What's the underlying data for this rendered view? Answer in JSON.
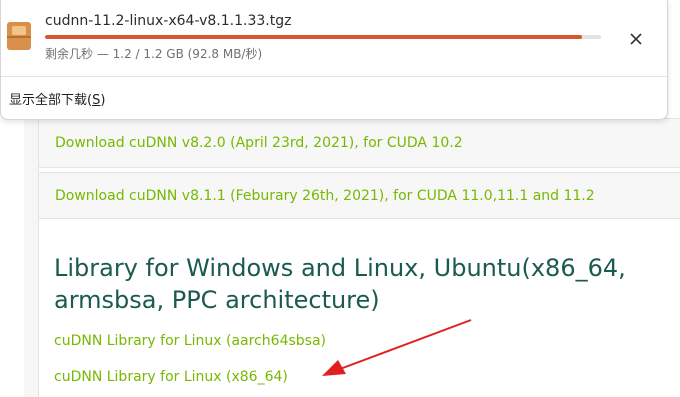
{
  "downloads_panel": {
    "file_name": "cudnn-11.2-linux-x64-v8.1.1.33.tgz",
    "progress_fraction": 0.965,
    "status_text": "剩余几秒 — 1.2 / 1.2 GB (92.8 MB/秒)",
    "show_all_label": "显示全部下载(",
    "show_all_key": "S",
    "show_all_suffix": ")",
    "file_icon": "archive-icon",
    "close_icon": "close-icon",
    "accent_color": "#d8572a"
  },
  "page": {
    "download_rows": [
      "Download cuDNN v8.2.0 (April 23rd, 2021), for CUDA 10.2",
      "Download cuDNN v8.1.1 (Feburary 26th, 2021), for CUDA 11.0,11.1 and 11.2"
    ],
    "section_title": "Library for Windows and Linux, Ubuntu(x86_64, armsbsa, PPC architecture)",
    "links": [
      "cuDNN Library for Linux (aarch64sbsa)",
      "cuDNN Library for Linux (x86_64)"
    ],
    "link_color": "#76b900",
    "title_color": "#1a5a4f",
    "annotation_arrow_color": "#e02020"
  }
}
